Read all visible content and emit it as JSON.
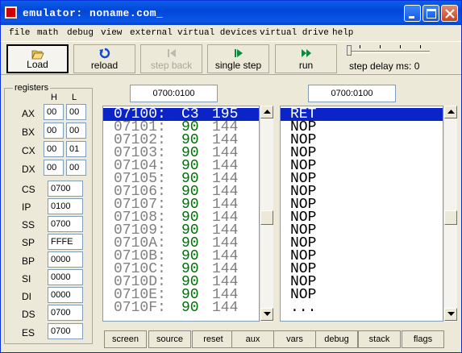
{
  "window": {
    "title": "emulator: noname.com_"
  },
  "menu": [
    "file",
    "math",
    "debug",
    "view",
    "external",
    "virtual devices",
    "virtual drive",
    "help"
  ],
  "toolbar": {
    "load": "Load",
    "reload": "reload",
    "step_back": "step back",
    "single_step": "single step",
    "run": "run",
    "step_delay": "step delay ms: 0"
  },
  "registers": {
    "title": "registers",
    "h": "H",
    "l": "L",
    "ax": {
      "name": "AX",
      "h": "00",
      "l": "00"
    },
    "bx": {
      "name": "BX",
      "h": "00",
      "l": "00"
    },
    "cx": {
      "name": "CX",
      "h": "00",
      "l": "01"
    },
    "dx": {
      "name": "DX",
      "h": "00",
      "l": "00"
    },
    "cs": {
      "name": "CS",
      "v": "0700"
    },
    "ip": {
      "name": "IP",
      "v": "0100"
    },
    "ss": {
      "name": "SS",
      "v": "0700"
    },
    "sp": {
      "name": "SP",
      "v": "FFFE"
    },
    "bp": {
      "name": "BP",
      "v": "0000"
    },
    "si": {
      "name": "SI",
      "v": "0000"
    },
    "di": {
      "name": "DI",
      "v": "0000"
    },
    "ds": {
      "name": "DS",
      "v": "0700"
    },
    "es": {
      "name": "ES",
      "v": "0700"
    }
  },
  "memory": {
    "address": "0700:0100",
    "rows": [
      {
        "addr": "07100:",
        "hex": "C3",
        "dec": "195"
      },
      {
        "addr": "07101:",
        "hex": "90",
        "dec": "144"
      },
      {
        "addr": "07102:",
        "hex": "90",
        "dec": "144"
      },
      {
        "addr": "07103:",
        "hex": "90",
        "dec": "144"
      },
      {
        "addr": "07104:",
        "hex": "90",
        "dec": "144"
      },
      {
        "addr": "07105:",
        "hex": "90",
        "dec": "144"
      },
      {
        "addr": "07106:",
        "hex": "90",
        "dec": "144"
      },
      {
        "addr": "07107:",
        "hex": "90",
        "dec": "144"
      },
      {
        "addr": "07108:",
        "hex": "90",
        "dec": "144"
      },
      {
        "addr": "07109:",
        "hex": "90",
        "dec": "144"
      },
      {
        "addr": "0710A:",
        "hex": "90",
        "dec": "144"
      },
      {
        "addr": "0710B:",
        "hex": "90",
        "dec": "144"
      },
      {
        "addr": "0710C:",
        "hex": "90",
        "dec": "144"
      },
      {
        "addr": "0710D:",
        "hex": "90",
        "dec": "144"
      },
      {
        "addr": "0710E:",
        "hex": "90",
        "dec": "144"
      },
      {
        "addr": "0710F:",
        "hex": "90",
        "dec": "144"
      }
    ]
  },
  "disasm": {
    "address": "0700:0100",
    "rows": [
      "RET",
      "NOP",
      "NOP",
      "NOP",
      "NOP",
      "NOP",
      "NOP",
      "NOP",
      "NOP",
      "NOP",
      "NOP",
      "NOP",
      "NOP",
      "NOP",
      "NOP",
      "...",
      ""
    ]
  },
  "bottom": [
    "screen",
    "source",
    "reset",
    "aux",
    "vars",
    "debug",
    "stack",
    "flags"
  ],
  "colors": {
    "title": "#0246d8",
    "selection": "#0a24c8",
    "hex": "#007000"
  }
}
